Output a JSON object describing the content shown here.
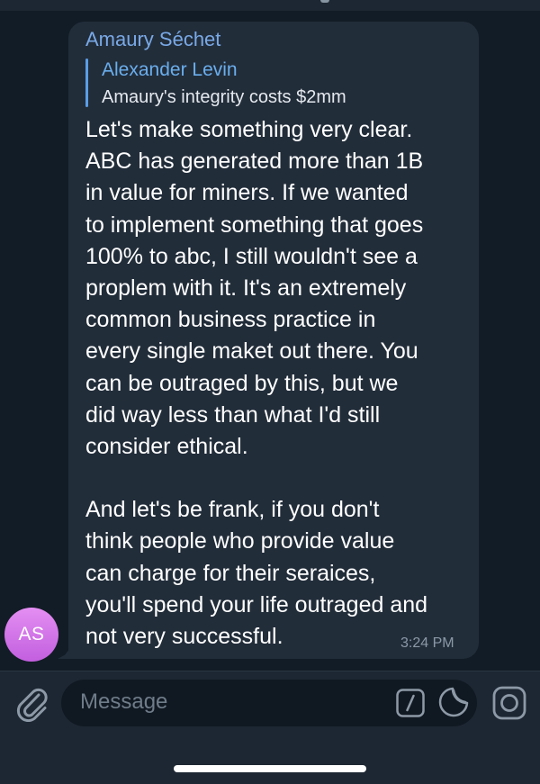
{
  "message": {
    "sender": "Amaury Séchet",
    "reply": {
      "author": "Alexander Levin",
      "text": "Amaury's integrity costs $2mm"
    },
    "lines": [
      "Let's make something very clear.",
      "ABC has generated more than 1B",
      "in value for miners. If we wanted",
      "to implement something that goes",
      "100% to abc, I still wouldn't see a",
      "proplem with it. It's an extremely",
      "common business practice in",
      "every single maket out there. You",
      "can be outraged by this, but we",
      "did way less than what I'd still",
      "consider ethical.",
      "",
      "And let's be frank, if you don't",
      "think people who provide value",
      "can charge for their seraices,",
      "you'll spend your life outraged and",
      "not very successful."
    ],
    "time": "3:24 PM"
  },
  "avatar": {
    "initials": "AS"
  },
  "input": {
    "placeholder": "Message"
  },
  "icons": {
    "attach": "paperclip-icon",
    "command": "slash-command-icon",
    "sticker": "sticker-icon",
    "camera": "camera-icon"
  },
  "colors": {
    "background": "#121c26",
    "bubble": "#222d3a",
    "sender_name": "#79a9e6",
    "reply_bar": "#5a9ee6",
    "avatar_gradient_top": "#e48ef2",
    "avatar_gradient_bottom": "#c25fdf",
    "input_bar": "#1d2733"
  }
}
